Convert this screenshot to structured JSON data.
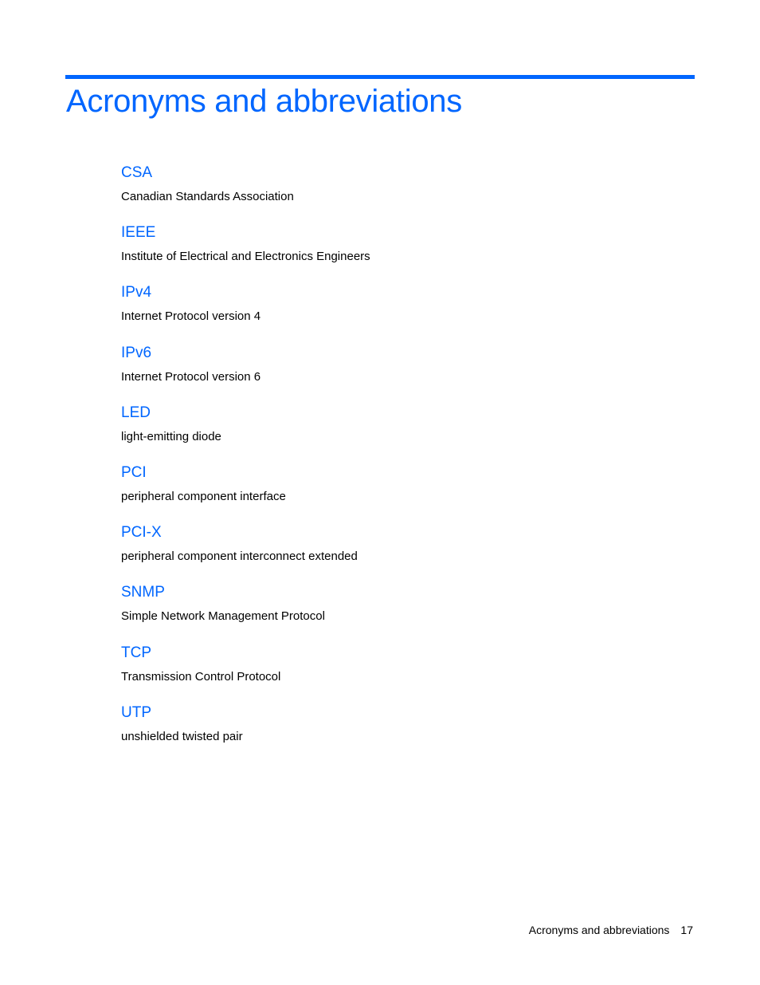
{
  "page": {
    "title": "Acronyms and abbreviations",
    "accent_color": "#0066ff",
    "entries": [
      {
        "term": "CSA",
        "definition": "Canadian Standards Association"
      },
      {
        "term": "IEEE",
        "definition": "Institute of Electrical and Electronics Engineers"
      },
      {
        "term": "IPv4",
        "definition": "Internet Protocol version 4"
      },
      {
        "term": "IPv6",
        "definition": "Internet Protocol version 6"
      },
      {
        "term": "LED",
        "definition": "light-emitting diode"
      },
      {
        "term": "PCI",
        "definition": "peripheral component interface"
      },
      {
        "term": "PCI-X",
        "definition": "peripheral component interconnect extended"
      },
      {
        "term": "SNMP",
        "definition": "Simple Network Management Protocol"
      },
      {
        "term": "TCP",
        "definition": "Transmission Control Protocol"
      },
      {
        "term": "UTP",
        "definition": "unshielded twisted pair"
      }
    ]
  },
  "footer": {
    "section": "Acronyms and abbreviations",
    "page_number": "17"
  }
}
